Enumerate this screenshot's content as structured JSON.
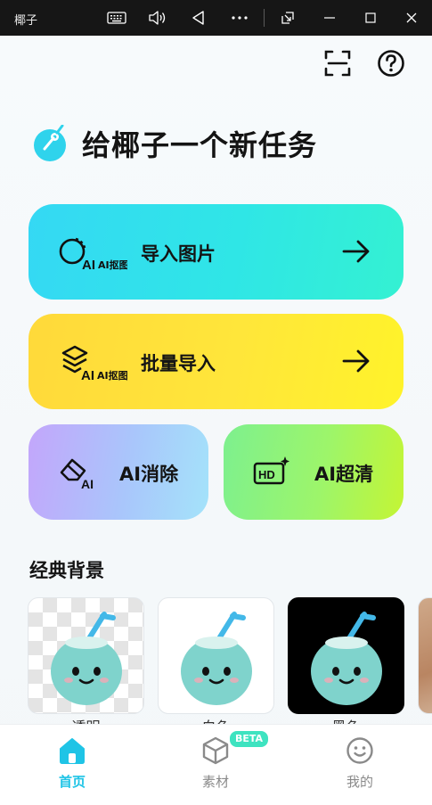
{
  "window": {
    "title": "椰子",
    "controls": [
      "keyboard-icon",
      "volume-icon",
      "back-triangle-icon",
      "more-dots-icon",
      "pip-icon",
      "minimize-icon",
      "maximize-icon",
      "close-icon"
    ]
  },
  "header": {
    "scan_icon": "scan-icon",
    "help_icon": "help-icon"
  },
  "hero": {
    "title": "给椰子一个新任务"
  },
  "actions": {
    "import": {
      "badge": "AI抠图",
      "label": "导入图片"
    },
    "batch": {
      "badge": "AI抠图",
      "label": "批量导入"
    },
    "erase": {
      "badge": "AI",
      "label": "AI消除"
    },
    "hd": {
      "badge": "HD",
      "label": "AI超清"
    }
  },
  "backgrounds": {
    "title": "经典背景",
    "items": [
      {
        "label": "透明"
      },
      {
        "label": "白色"
      },
      {
        "label": "黑色"
      }
    ]
  },
  "nav": {
    "home": "首页",
    "materials": "素材",
    "materials_badge": "BETA",
    "mine": "我的"
  },
  "colors": {
    "accent": "#1fc4e6",
    "import_card": "#35d8f4",
    "batch_card": "#ffe63a",
    "erase_card": "#b0b9fb",
    "hd_card": "#9df56a",
    "beta_badge": "#3ee3c0"
  }
}
